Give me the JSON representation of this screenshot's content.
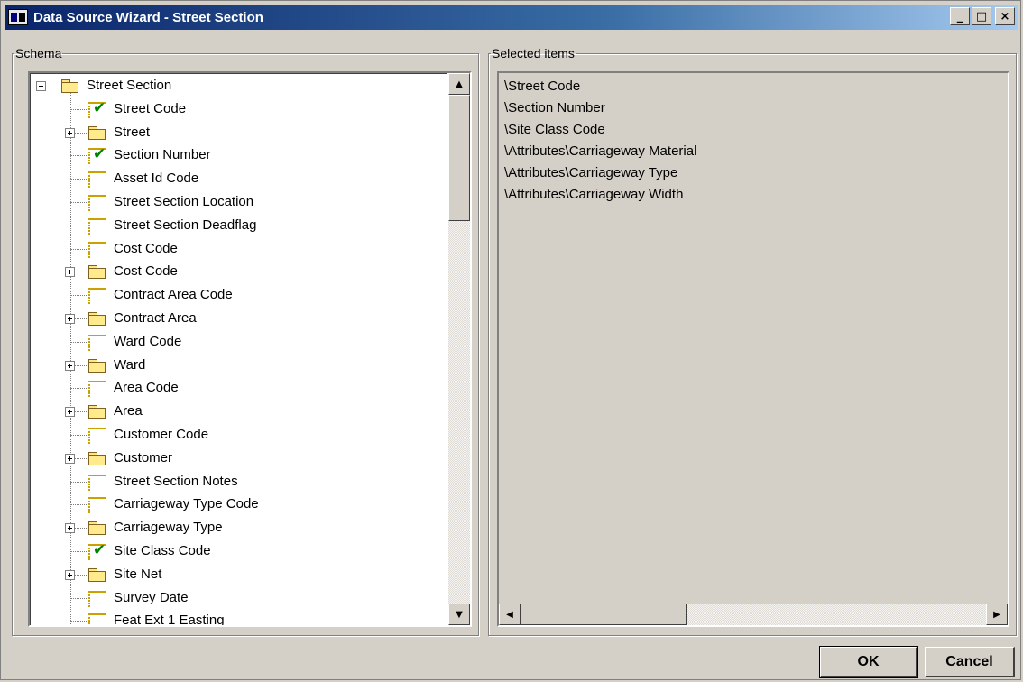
{
  "window": {
    "title": "Data Source Wizard - Street Section",
    "buttons": {
      "minimize": "_",
      "maximize": "□",
      "close": "×"
    }
  },
  "schema": {
    "legend": "Schema",
    "items": [
      {
        "label": "Street Section",
        "type": "folder",
        "expander": "−",
        "level": 0,
        "checked": false
      },
      {
        "label": "Street Code",
        "type": "field",
        "level": 1,
        "checked": true
      },
      {
        "label": "Street",
        "type": "folder",
        "expander": "+",
        "level": 1,
        "checked": false
      },
      {
        "label": "Section Number",
        "type": "field",
        "level": 1,
        "checked": true
      },
      {
        "label": "Asset Id Code",
        "type": "field",
        "level": 1,
        "checked": false
      },
      {
        "label": "Street Section Location",
        "type": "field",
        "level": 1,
        "checked": false
      },
      {
        "label": "Street Section Deadflag",
        "type": "field",
        "level": 1,
        "checked": false
      },
      {
        "label": "Cost Code",
        "type": "field",
        "level": 1,
        "checked": false
      },
      {
        "label": "Cost Code",
        "type": "folder",
        "expander": "+",
        "level": 1,
        "checked": false
      },
      {
        "label": "Contract Area Code",
        "type": "field",
        "level": 1,
        "checked": false
      },
      {
        "label": "Contract Area",
        "type": "folder",
        "expander": "+",
        "level": 1,
        "checked": false
      },
      {
        "label": "Ward Code",
        "type": "field",
        "level": 1,
        "checked": false
      },
      {
        "label": "Ward",
        "type": "folder",
        "expander": "+",
        "level": 1,
        "checked": false
      },
      {
        "label": "Area Code",
        "type": "field",
        "level": 1,
        "checked": false
      },
      {
        "label": "Area",
        "type": "folder",
        "expander": "+",
        "level": 1,
        "checked": false
      },
      {
        "label": "Customer Code",
        "type": "field",
        "level": 1,
        "checked": false
      },
      {
        "label": "Customer",
        "type": "folder",
        "expander": "+",
        "level": 1,
        "checked": false
      },
      {
        "label": "Street Section Notes",
        "type": "field",
        "level": 1,
        "checked": false
      },
      {
        "label": "Carriageway Type Code",
        "type": "field",
        "level": 1,
        "checked": false
      },
      {
        "label": "Carriageway Type",
        "type": "folder",
        "expander": "+",
        "level": 1,
        "checked": false
      },
      {
        "label": "Site Class Code",
        "type": "field",
        "level": 1,
        "checked": true
      },
      {
        "label": "Site Net",
        "type": "folder",
        "expander": "+",
        "level": 1,
        "checked": false
      },
      {
        "label": "Survey Date",
        "type": "field",
        "level": 1,
        "checked": false
      },
      {
        "label": "Feat Ext 1 Easting",
        "type": "field",
        "level": 1,
        "checked": false
      }
    ]
  },
  "selected": {
    "legend": "Selected items",
    "items": [
      "\\Street Code",
      "\\Section Number",
      "\\Site Class Code",
      "\\Attributes\\Carriageway Material",
      "\\Attributes\\Carriageway Type",
      "\\Attributes\\Carriageway Width"
    ]
  },
  "footer": {
    "ok_label": "OK",
    "cancel_label": "Cancel"
  },
  "scroll_arrows": {
    "up": "▲",
    "down": "▼",
    "left": "◀",
    "right": "▶"
  },
  "icons": {
    "folder": "folder-icon",
    "field": "field-icon",
    "check": "checkmark-icon",
    "expand": "plus-box-icon",
    "collapse": "minus-box-icon"
  }
}
